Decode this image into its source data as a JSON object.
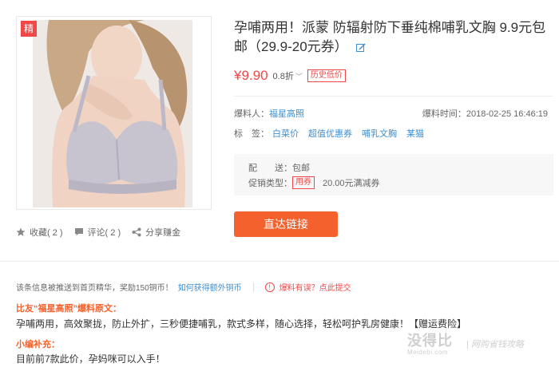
{
  "product": {
    "badge": "精",
    "title": "孕哺两用！派蒙 防辐射防下垂纯棉哺乳文胸 9.9元包邮（29.9-20元券）",
    "price": "¥9.90",
    "discount": "0.8折",
    "low_price_badge": "历史低价",
    "image_icon": "bra-product-photo"
  },
  "actions": {
    "favorite": "收藏( 2 )",
    "comment": "评论( 2 )",
    "share": "分享赚金"
  },
  "meta": {
    "reporter_label": "爆料人：",
    "reporter_name": "福星高照",
    "time": "爆料时间：2018-02-25 16:46:19",
    "tags_label": "标　签：",
    "tags": [
      "白菜价",
      "超值优惠券",
      "哺乳文胸",
      "某猫"
    ]
  },
  "shipping": {
    "ship_label": "配　　送：",
    "ship_value": "包邮",
    "promo_label": "促销类型：",
    "promo_badge": "用券",
    "promo_value": "20.00元满减券"
  },
  "go_button": "直达链接",
  "notice": {
    "text": "该条信息被推送到首页精华，奖励150铜币！",
    "link": "如何获得额外铜币",
    "warn_link": "爆料有误？点此提交"
  },
  "original": {
    "heading": "比友“福星高照”爆料原文：",
    "body": "孕哺两用，高效聚拢，防止外扩，三秒便捷哺乳，款式多样，随心选择，轻松呵护乳房健康！【赠运费险】"
  },
  "editor": {
    "heading": "小编补充：",
    "body": "目前前7款此价，孕妈咪可以入手！"
  },
  "watermark": {
    "main": "没得比",
    "sub": "Meidebi.com",
    "slogan": "| 网购省钱攻略"
  },
  "colors": {
    "accent": "#f04848",
    "button": "#f4612c",
    "link": "#3d8fd1"
  }
}
